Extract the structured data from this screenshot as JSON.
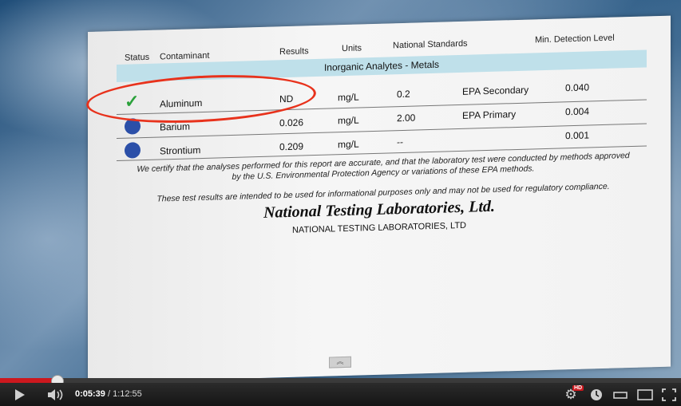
{
  "report": {
    "headers": {
      "status": "Status",
      "contaminant": "Contaminant",
      "results": "Results",
      "units": "Units",
      "national_standards": "National Standards",
      "min_detection": "Min. Detection Level"
    },
    "section_title": "Inorganic Analytes - Metals",
    "rows": [
      {
        "status": "check",
        "contaminant": "Aluminum",
        "result": "ND",
        "units": "mg/L",
        "standard_value": "0.2",
        "standard_type": "EPA Secondary",
        "min_detection": "0.040"
      },
      {
        "status": "dot",
        "contaminant": "Barium",
        "result": "0.026",
        "units": "mg/L",
        "standard_value": "2.00",
        "standard_type": "EPA Primary",
        "min_detection": "0.004"
      },
      {
        "status": "dot",
        "contaminant": "Strontium",
        "result": "0.209",
        "units": "mg/L",
        "standard_value": "--",
        "standard_type": "",
        "min_detection": "0.001"
      }
    ],
    "certification_line1": "We certify that the analyses performed for this report are accurate, and that the laboratory test were conducted by methods approved",
    "certification_line2": "by the U.S. Environmental Protection Agency or variations of these EPA methods.",
    "disclaimer": "These test results are intended to be used for informational purposes only and may not be used for regulatory compliance.",
    "lab_name_script": "National Testing Laboratories, Ltd.",
    "lab_name_caps": "NATIONAL TESTING LABORATORIES, LTD"
  },
  "player": {
    "current_time": "0:05:39",
    "separator": " / ",
    "duration": "1:12:55",
    "hd_badge": "HD",
    "progress_fraction": 0.078,
    "colors": {
      "progress": "#cc181e",
      "highlight_circle": "#e8321c"
    }
  },
  "colors": {
    "section_band": "#bfe0ea",
    "status_dot": "#2b4fa8",
    "status_check": "#2aa13a"
  }
}
